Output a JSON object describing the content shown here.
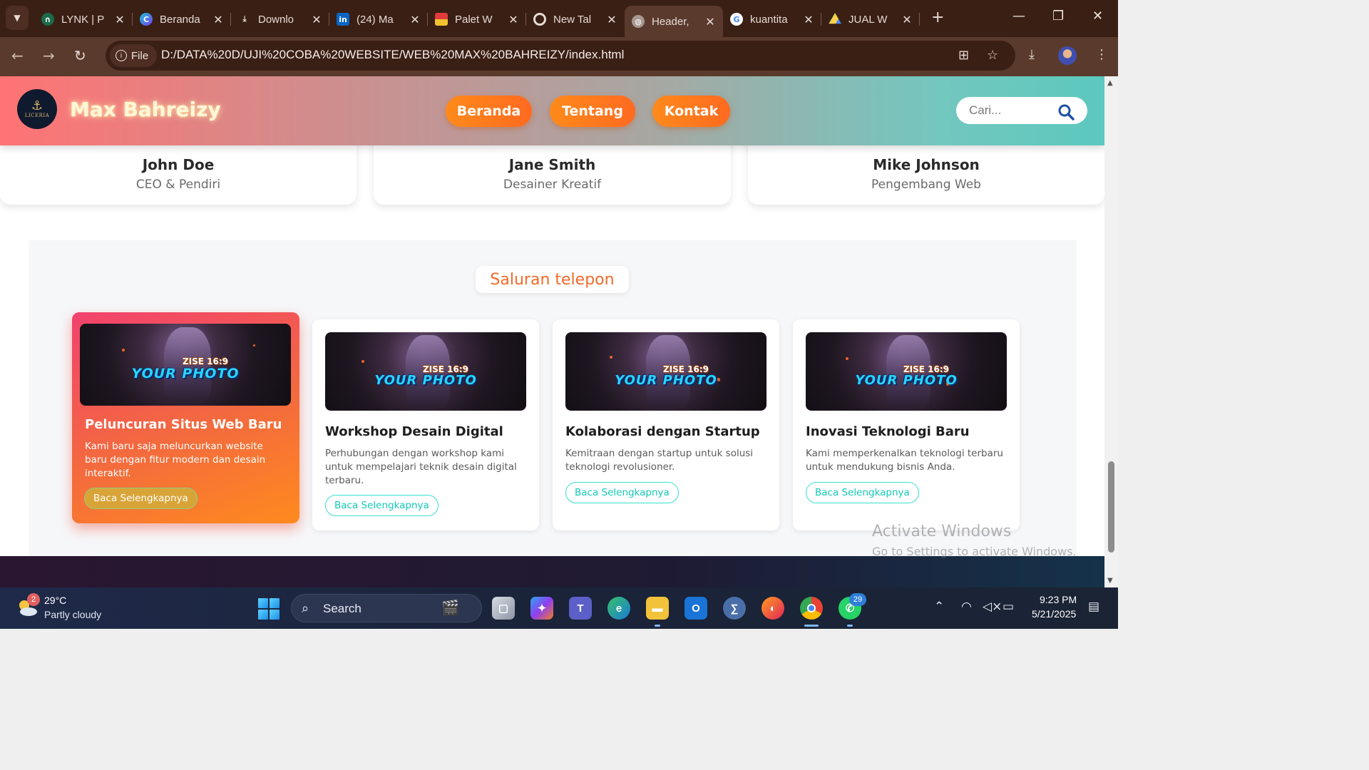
{
  "browser": {
    "tabs": [
      {
        "title": "LYNK | P",
        "icon": "lynk-icon",
        "active": false
      },
      {
        "title": "Beranda",
        "icon": "canva-icon",
        "active": false
      },
      {
        "title": "Downlo",
        "icon": "download-icon",
        "active": false
      },
      {
        "title": "(24) Ma",
        "icon": "linkedin-icon",
        "active": false
      },
      {
        "title": "Palet W",
        "icon": "palette-icon",
        "active": false
      },
      {
        "title": "New Tal",
        "icon": "chrome-icon",
        "active": false
      },
      {
        "title": "Header,",
        "icon": "globe-icon",
        "active": true
      },
      {
        "title": "kuantita",
        "icon": "google-icon",
        "active": false
      },
      {
        "title": "JUAL W",
        "icon": "drive-icon",
        "active": false
      }
    ],
    "omnibox": {
      "chip_label": "File",
      "url": "D:/DATA%20D/UJI%20COBA%20WEBSITE/WEB%20MAX%20BAHREIZY/index.html"
    }
  },
  "site": {
    "logo_text": "LICERIA",
    "brand": "Max Bahreizy",
    "nav": [
      "Beranda",
      "Tentang",
      "Kontak"
    ],
    "search_placeholder": "Cari...",
    "accent": "#ff7a1a"
  },
  "team": [
    {
      "name": "John Doe",
      "role": "CEO & Pendiri"
    },
    {
      "name": "Jane Smith",
      "role": "Desainer Kreatif"
    },
    {
      "name": "Mike Johnson",
      "role": "Pengembang Web"
    }
  ],
  "news": {
    "section_title": "Saluran telepon",
    "thumb_caption_small": "ZISE 16:9",
    "thumb_caption_big": "YOUR PHOTO",
    "cards": [
      {
        "title": "Peluncuran Situs Web Baru",
        "text": "Kami baru saja meluncurkan website baru dengan fitur modern dan desain interaktif.",
        "button": "Baca Selengkapnya",
        "featured": true
      },
      {
        "title": "Workshop Desain Digital",
        "text": "Perhubungan dengan workshop kami untuk mempelajari teknik desain digital terbaru.",
        "button": "Baca Selengkapnya",
        "featured": false
      },
      {
        "title": "Kolaborasi dengan Startup",
        "text": "Kemitraan dengan startup untuk solusi teknologi revolusioner.",
        "button": "Baca Selengkapnya",
        "featured": false
      },
      {
        "title": "Inovasi Teknologi Baru",
        "text": "Kami memperkenalkan teknologi terbaru untuk mendukung bisnis Anda.",
        "button": "Baca Selengkapnya",
        "featured": false
      }
    ]
  },
  "watermark": {
    "line1": "Activate Windows",
    "line2": "Go to Settings to activate Windows."
  },
  "taskbar": {
    "weather_badge": "2",
    "temperature": "29°C",
    "condition": "Partly cloudy",
    "search_label": "Search",
    "whatsapp_badge": "29",
    "time": "9:23 PM",
    "date": "5/21/2025"
  }
}
